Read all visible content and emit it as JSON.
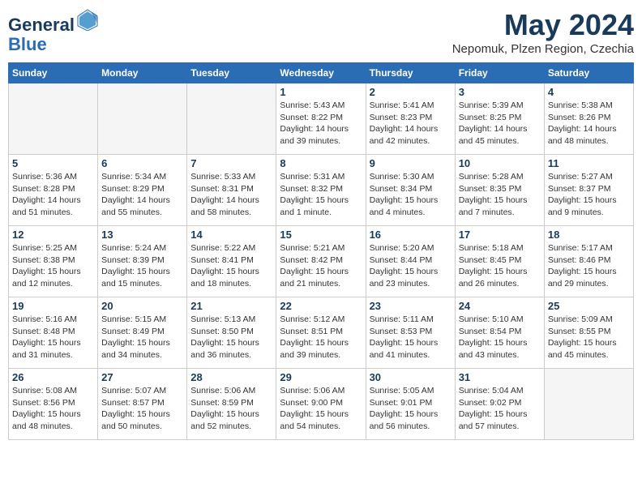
{
  "logo": {
    "line1": "General",
    "line2": "Blue"
  },
  "title": "May 2024",
  "subtitle": "Nepomuk, Plzen Region, Czechia",
  "days_of_week": [
    "Sunday",
    "Monday",
    "Tuesday",
    "Wednesday",
    "Thursday",
    "Friday",
    "Saturday"
  ],
  "weeks": [
    [
      {
        "day": "",
        "info": ""
      },
      {
        "day": "",
        "info": ""
      },
      {
        "day": "",
        "info": ""
      },
      {
        "day": "1",
        "info": "Sunrise: 5:43 AM\nSunset: 8:22 PM\nDaylight: 14 hours\nand 39 minutes."
      },
      {
        "day": "2",
        "info": "Sunrise: 5:41 AM\nSunset: 8:23 PM\nDaylight: 14 hours\nand 42 minutes."
      },
      {
        "day": "3",
        "info": "Sunrise: 5:39 AM\nSunset: 8:25 PM\nDaylight: 14 hours\nand 45 minutes."
      },
      {
        "day": "4",
        "info": "Sunrise: 5:38 AM\nSunset: 8:26 PM\nDaylight: 14 hours\nand 48 minutes."
      }
    ],
    [
      {
        "day": "5",
        "info": "Sunrise: 5:36 AM\nSunset: 8:28 PM\nDaylight: 14 hours\nand 51 minutes."
      },
      {
        "day": "6",
        "info": "Sunrise: 5:34 AM\nSunset: 8:29 PM\nDaylight: 14 hours\nand 55 minutes."
      },
      {
        "day": "7",
        "info": "Sunrise: 5:33 AM\nSunset: 8:31 PM\nDaylight: 14 hours\nand 58 minutes."
      },
      {
        "day": "8",
        "info": "Sunrise: 5:31 AM\nSunset: 8:32 PM\nDaylight: 15 hours\nand 1 minute."
      },
      {
        "day": "9",
        "info": "Sunrise: 5:30 AM\nSunset: 8:34 PM\nDaylight: 15 hours\nand 4 minutes."
      },
      {
        "day": "10",
        "info": "Sunrise: 5:28 AM\nSunset: 8:35 PM\nDaylight: 15 hours\nand 7 minutes."
      },
      {
        "day": "11",
        "info": "Sunrise: 5:27 AM\nSunset: 8:37 PM\nDaylight: 15 hours\nand 9 minutes."
      }
    ],
    [
      {
        "day": "12",
        "info": "Sunrise: 5:25 AM\nSunset: 8:38 PM\nDaylight: 15 hours\nand 12 minutes."
      },
      {
        "day": "13",
        "info": "Sunrise: 5:24 AM\nSunset: 8:39 PM\nDaylight: 15 hours\nand 15 minutes."
      },
      {
        "day": "14",
        "info": "Sunrise: 5:22 AM\nSunset: 8:41 PM\nDaylight: 15 hours\nand 18 minutes."
      },
      {
        "day": "15",
        "info": "Sunrise: 5:21 AM\nSunset: 8:42 PM\nDaylight: 15 hours\nand 21 minutes."
      },
      {
        "day": "16",
        "info": "Sunrise: 5:20 AM\nSunset: 8:44 PM\nDaylight: 15 hours\nand 23 minutes."
      },
      {
        "day": "17",
        "info": "Sunrise: 5:18 AM\nSunset: 8:45 PM\nDaylight: 15 hours\nand 26 minutes."
      },
      {
        "day": "18",
        "info": "Sunrise: 5:17 AM\nSunset: 8:46 PM\nDaylight: 15 hours\nand 29 minutes."
      }
    ],
    [
      {
        "day": "19",
        "info": "Sunrise: 5:16 AM\nSunset: 8:48 PM\nDaylight: 15 hours\nand 31 minutes."
      },
      {
        "day": "20",
        "info": "Sunrise: 5:15 AM\nSunset: 8:49 PM\nDaylight: 15 hours\nand 34 minutes."
      },
      {
        "day": "21",
        "info": "Sunrise: 5:13 AM\nSunset: 8:50 PM\nDaylight: 15 hours\nand 36 minutes."
      },
      {
        "day": "22",
        "info": "Sunrise: 5:12 AM\nSunset: 8:51 PM\nDaylight: 15 hours\nand 39 minutes."
      },
      {
        "day": "23",
        "info": "Sunrise: 5:11 AM\nSunset: 8:53 PM\nDaylight: 15 hours\nand 41 minutes."
      },
      {
        "day": "24",
        "info": "Sunrise: 5:10 AM\nSunset: 8:54 PM\nDaylight: 15 hours\nand 43 minutes."
      },
      {
        "day": "25",
        "info": "Sunrise: 5:09 AM\nSunset: 8:55 PM\nDaylight: 15 hours\nand 45 minutes."
      }
    ],
    [
      {
        "day": "26",
        "info": "Sunrise: 5:08 AM\nSunset: 8:56 PM\nDaylight: 15 hours\nand 48 minutes."
      },
      {
        "day": "27",
        "info": "Sunrise: 5:07 AM\nSunset: 8:57 PM\nDaylight: 15 hours\nand 50 minutes."
      },
      {
        "day": "28",
        "info": "Sunrise: 5:06 AM\nSunset: 8:59 PM\nDaylight: 15 hours\nand 52 minutes."
      },
      {
        "day": "29",
        "info": "Sunrise: 5:06 AM\nSunset: 9:00 PM\nDaylight: 15 hours\nand 54 minutes."
      },
      {
        "day": "30",
        "info": "Sunrise: 5:05 AM\nSunset: 9:01 PM\nDaylight: 15 hours\nand 56 minutes."
      },
      {
        "day": "31",
        "info": "Sunrise: 5:04 AM\nSunset: 9:02 PM\nDaylight: 15 hours\nand 57 minutes."
      },
      {
        "day": "",
        "info": ""
      }
    ]
  ]
}
